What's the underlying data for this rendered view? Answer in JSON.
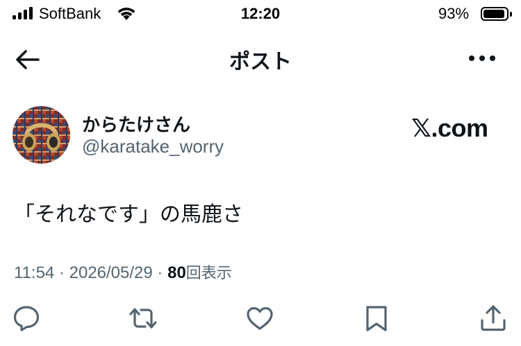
{
  "status_bar": {
    "carrier": "SoftBank",
    "time": "12:20",
    "battery_percent": "93%",
    "battery_level": 0.93
  },
  "nav": {
    "title": "ポスト"
  },
  "post": {
    "author": {
      "display_name": "からたけさん",
      "handle": "@karatake_worry"
    },
    "watermark": "𝕏.com",
    "text": "「それなです」の馬鹿さ",
    "time": "11:54",
    "separator": "·",
    "date": "2026/05/29",
    "views_count": "80",
    "views_label": "回表示"
  },
  "actions": [
    {
      "name": "reply",
      "icon": "speech-bubble-icon"
    },
    {
      "name": "repost",
      "icon": "repost-arrows-icon"
    },
    {
      "name": "like",
      "icon": "heart-icon"
    },
    {
      "name": "bookmark",
      "icon": "bookmark-icon"
    },
    {
      "name": "share",
      "icon": "share-upload-icon"
    }
  ]
}
